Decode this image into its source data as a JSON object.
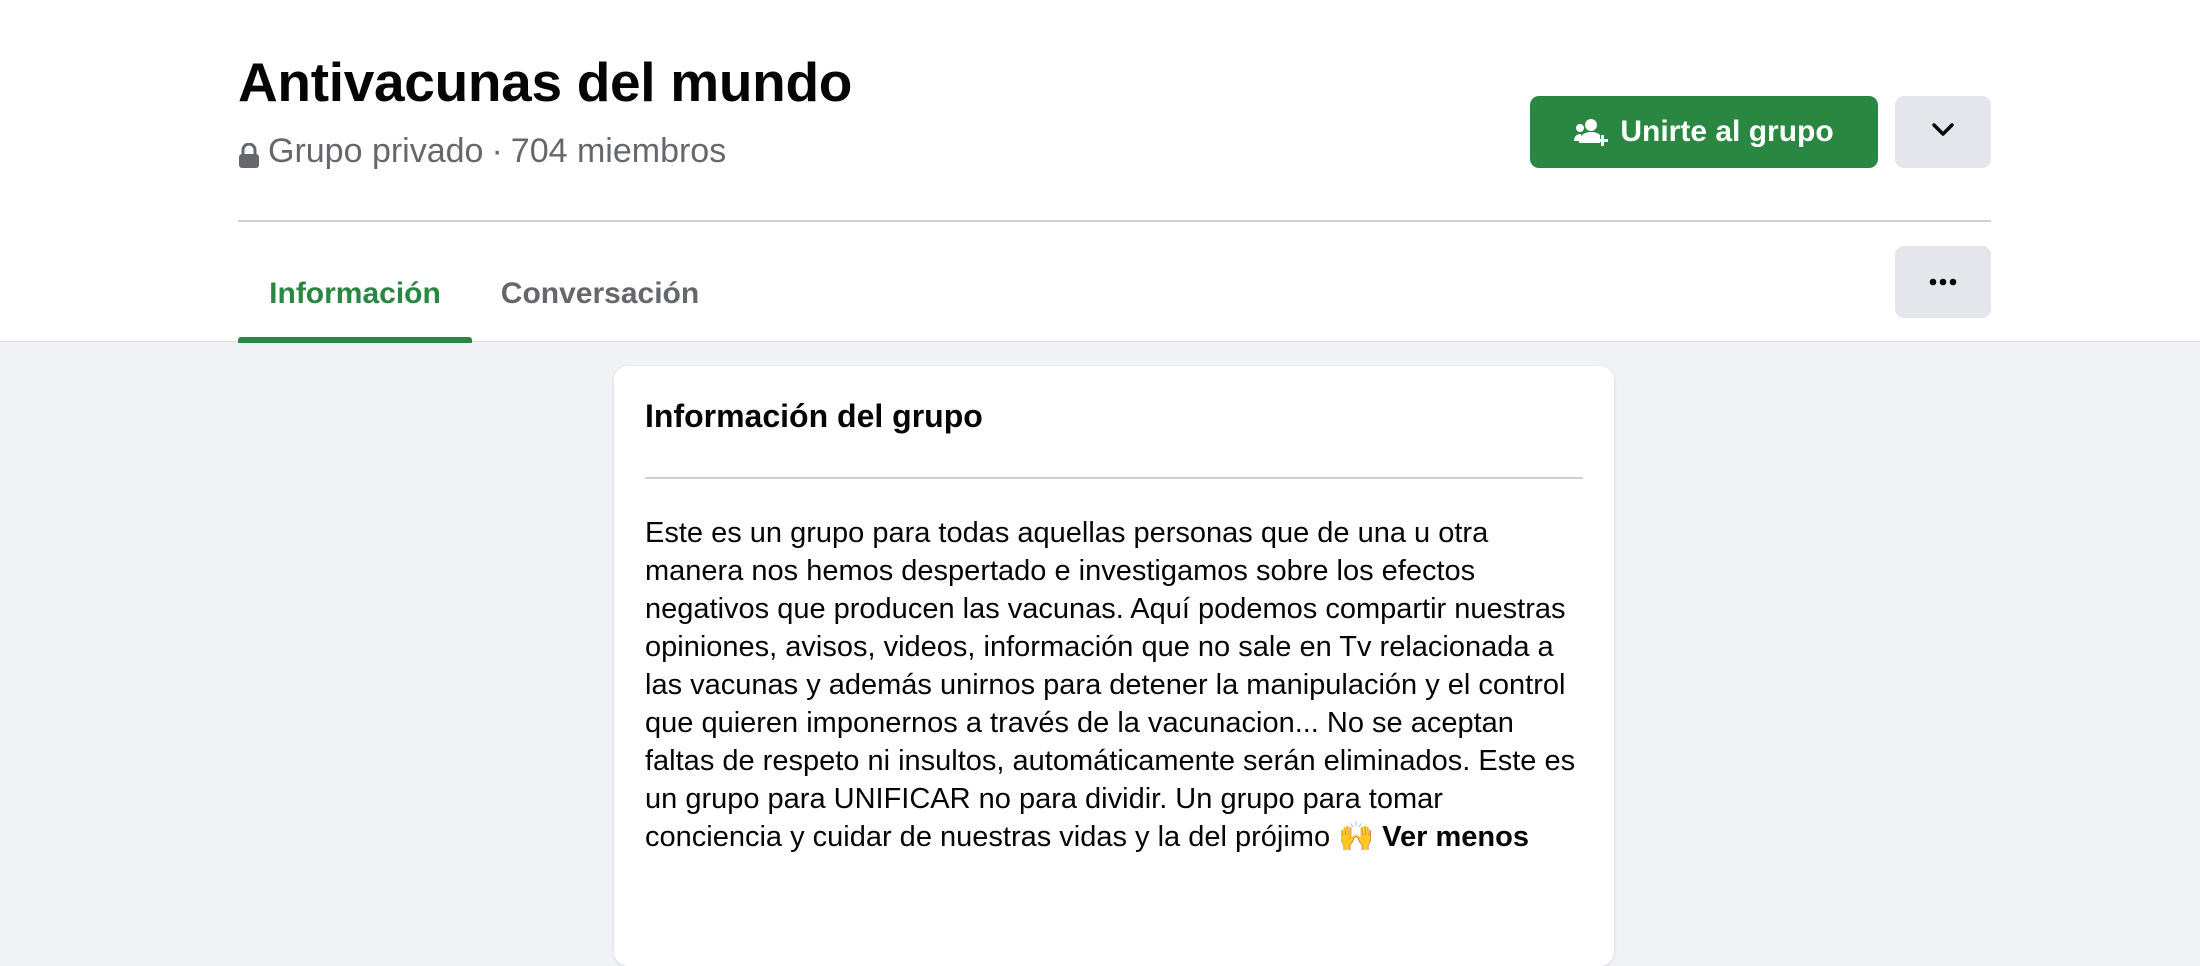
{
  "group": {
    "name": "Antivacunas del mundo",
    "privacy": "Grupo privado",
    "separator": "·",
    "members": "704 miembros"
  },
  "actions": {
    "join_label": "Unirte al grupo"
  },
  "tabs": [
    {
      "label": "Información",
      "active": true
    },
    {
      "label": "Conversación",
      "active": false
    }
  ],
  "about": {
    "title": "Información del grupo",
    "description": "Este es un grupo para todas aquellas personas que de una u otra manera nos hemos despertado e investigamos sobre los efectos negativos que producen las vacunas. Aquí podemos compartir nuestras opiniones, avisos, videos, información que no sale en Tv relacionada a las vacunas y además unirnos para detener la manipulación y el control que quieren imponernos a través de la vacunacion... No se aceptan faltas de respeto ni insultos, automáticamente serán eliminados. Este es un grupo para UNIFICAR no para dividir. Un grupo para tomar conciencia y cuidar de nuestras vidas y la del prójimo 🙌",
    "see_less": "Ver menos"
  },
  "colors": {
    "accent": "#2a8741",
    "background": "#f0f2f5",
    "secondary_button": "#e4e6eb",
    "muted_text": "#65676b"
  },
  "icons": {
    "privacy": "lock-icon",
    "join": "group-add-icon",
    "dropdown": "chevron-down-icon",
    "more": "more-horizontal-icon"
  }
}
